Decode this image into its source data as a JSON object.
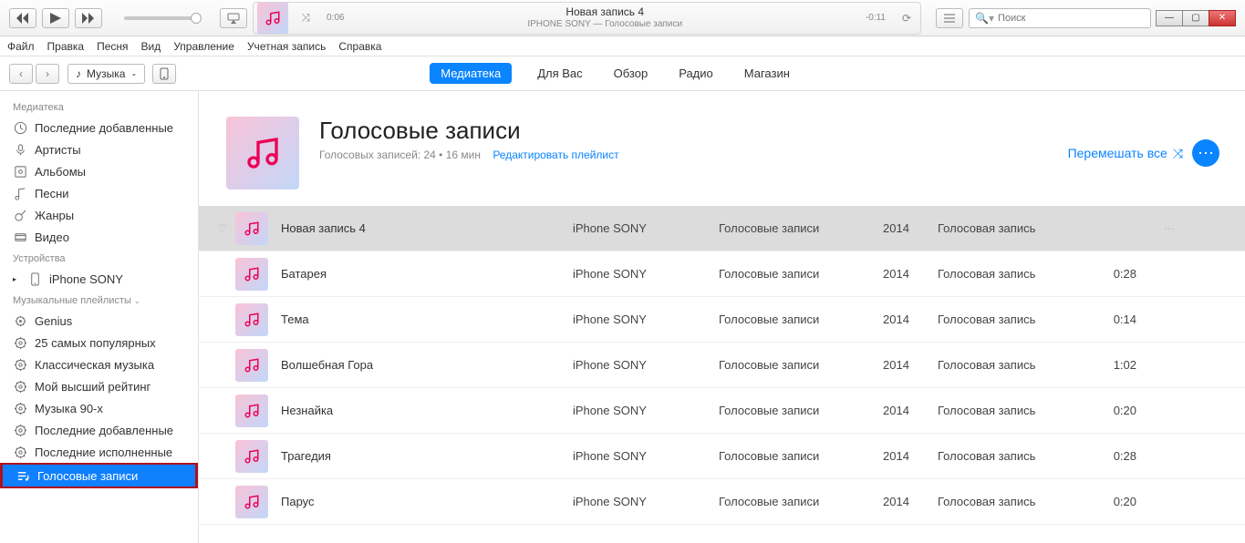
{
  "topbar": {
    "now_playing_title": "Новая запись 4",
    "now_playing_sub": "IPHONE SONY — Голосовые записи",
    "time_elapsed": "0:06",
    "time_remaining": "-0:11",
    "search_placeholder": "Поиск"
  },
  "menubar": [
    "Файл",
    "Правка",
    "Песня",
    "Вид",
    "Управление",
    "Учетная запись",
    "Справка"
  ],
  "nav": {
    "media_selector": "Музыка",
    "tabs": [
      {
        "label": "Медиатека",
        "active": true
      },
      {
        "label": "Для Вас",
        "active": false
      },
      {
        "label": "Обзор",
        "active": false
      },
      {
        "label": "Радио",
        "active": false
      },
      {
        "label": "Магазин",
        "active": false
      }
    ]
  },
  "sidebar": {
    "sections": [
      {
        "header": "Медиатека",
        "items": [
          {
            "icon": "clock",
            "label": "Последние добавленные"
          },
          {
            "icon": "mic",
            "label": "Артисты"
          },
          {
            "icon": "album",
            "label": "Альбомы"
          },
          {
            "icon": "note",
            "label": "Песни"
          },
          {
            "icon": "guitar",
            "label": "Жанры"
          },
          {
            "icon": "video",
            "label": "Видео"
          }
        ]
      },
      {
        "header": "Устройства",
        "items": [
          {
            "icon": "iphone",
            "label": "iPhone SONY",
            "expandable": true
          }
        ]
      },
      {
        "header": "Музыкальные плейлисты",
        "items": [
          {
            "icon": "genius",
            "label": "Genius"
          },
          {
            "icon": "gear",
            "label": "25 самых популярных"
          },
          {
            "icon": "gear",
            "label": "Классическая музыка"
          },
          {
            "icon": "gear",
            "label": "Мой высший рейтинг"
          },
          {
            "icon": "gear",
            "label": "Музыка 90-х"
          },
          {
            "icon": "gear",
            "label": "Последние добавленные"
          },
          {
            "icon": "gear",
            "label": "Последние исполненные"
          },
          {
            "icon": "playlist",
            "label": "Голосовые записи",
            "active": true
          }
        ]
      }
    ]
  },
  "playlist": {
    "title": "Голосовые записи",
    "meta": "Голосовых записей: 24 • 16 мин",
    "edit_label": "Редактировать плейлист",
    "shuffle_label": "Перемешать все",
    "tracks": [
      {
        "name": "Новая запись 4",
        "artist": "iPhone SONY",
        "album": "Голосовые записи",
        "year": "2014",
        "genre": "Голосовая запись",
        "duration": "",
        "selected": true
      },
      {
        "name": "Батарея",
        "artist": "iPhone SONY",
        "album": "Голосовые записи",
        "year": "2014",
        "genre": "Голосовая запись",
        "duration": "0:28"
      },
      {
        "name": "Тема",
        "artist": "iPhone SONY",
        "album": "Голосовые записи",
        "year": "2014",
        "genre": "Голосовая запись",
        "duration": "0:14"
      },
      {
        "name": "Волшебная Гора",
        "artist": "iPhone SONY",
        "album": "Голосовые записи",
        "year": "2014",
        "genre": "Голосовая запись",
        "duration": "1:02"
      },
      {
        "name": "Незнайка",
        "artist": "iPhone SONY",
        "album": "Голосовые записи",
        "year": "2014",
        "genre": "Голосовая запись",
        "duration": "0:20"
      },
      {
        "name": "Трагедия",
        "artist": "iPhone SONY",
        "album": "Голосовые записи",
        "year": "2014",
        "genre": "Голосовая запись",
        "duration": "0:28"
      },
      {
        "name": "Парус",
        "artist": "iPhone SONY",
        "album": "Голосовые записи",
        "year": "2014",
        "genre": "Голосовая запись",
        "duration": "0:20"
      }
    ]
  }
}
